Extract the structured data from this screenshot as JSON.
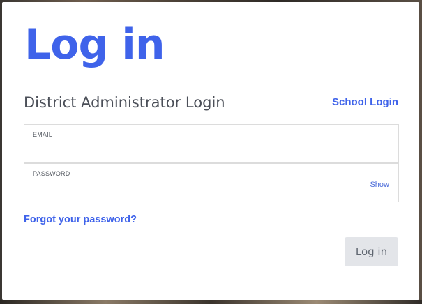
{
  "dialog": {
    "title": "Log in",
    "subtitle": "District Administrator Login",
    "school_login_link": "School Login"
  },
  "form": {
    "email": {
      "label": "EMAIL",
      "value": ""
    },
    "password": {
      "label": "PASSWORD",
      "value": "",
      "show_label": "Show"
    },
    "forgot_password_link": "Forgot your password?",
    "submit_label": "Log in"
  },
  "colors": {
    "accent": "#3f63ea",
    "button_bg": "#e3e5e9",
    "button_text": "#5f6670",
    "subtitle_text": "#4b4f58",
    "field_border": "#dcdcdc"
  }
}
